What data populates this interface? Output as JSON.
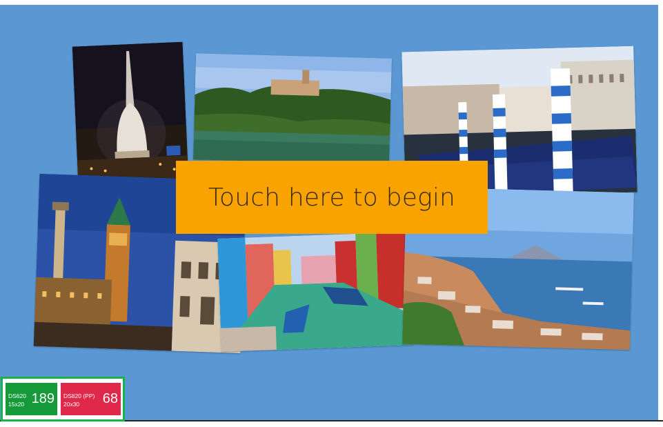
{
  "prompt": {
    "label": "Touch here to begin"
  },
  "photos": [
    {
      "subject": "Mole Antonelliana at night"
    },
    {
      "subject": "Hillside castle above lake"
    },
    {
      "subject": "Venice gondolas"
    },
    {
      "subject": "Piazza San Marco campanile"
    },
    {
      "subject": "Burano canal"
    },
    {
      "subject": "Bay of Naples with Vesuvius"
    }
  ],
  "counters": [
    {
      "line1": "DS620",
      "line2": "15x20",
      "value": "189",
      "color": "#159a3a"
    },
    {
      "line1": "DS820 (PP)",
      "line2": "20x30",
      "value": "68",
      "color": "#e0284a"
    }
  ],
  "colors": {
    "background": "#5a97d3",
    "accent": "#f9a300",
    "counter_border": "#16b24a"
  }
}
